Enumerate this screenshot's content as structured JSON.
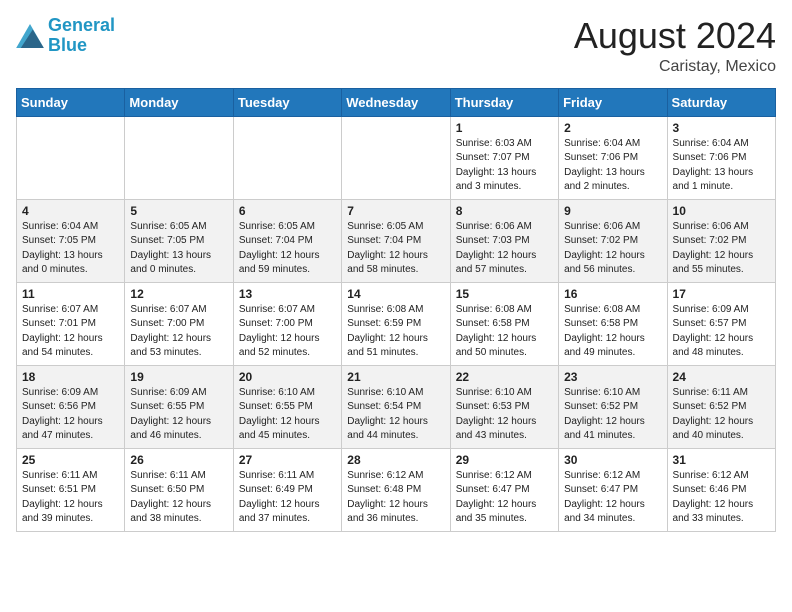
{
  "header": {
    "logo_line1": "General",
    "logo_line2": "Blue",
    "month_year": "August 2024",
    "location": "Caristay, Mexico"
  },
  "weekdays": [
    "Sunday",
    "Monday",
    "Tuesday",
    "Wednesday",
    "Thursday",
    "Friday",
    "Saturday"
  ],
  "weeks": [
    [
      {
        "day": "",
        "info": ""
      },
      {
        "day": "",
        "info": ""
      },
      {
        "day": "",
        "info": ""
      },
      {
        "day": "",
        "info": ""
      },
      {
        "day": "1",
        "info": "Sunrise: 6:03 AM\nSunset: 7:07 PM\nDaylight: 13 hours\nand 3 minutes."
      },
      {
        "day": "2",
        "info": "Sunrise: 6:04 AM\nSunset: 7:06 PM\nDaylight: 13 hours\nand 2 minutes."
      },
      {
        "day": "3",
        "info": "Sunrise: 6:04 AM\nSunset: 7:06 PM\nDaylight: 13 hours\nand 1 minute."
      }
    ],
    [
      {
        "day": "4",
        "info": "Sunrise: 6:04 AM\nSunset: 7:05 PM\nDaylight: 13 hours\nand 0 minutes."
      },
      {
        "day": "5",
        "info": "Sunrise: 6:05 AM\nSunset: 7:05 PM\nDaylight: 13 hours\nand 0 minutes."
      },
      {
        "day": "6",
        "info": "Sunrise: 6:05 AM\nSunset: 7:04 PM\nDaylight: 12 hours\nand 59 minutes."
      },
      {
        "day": "7",
        "info": "Sunrise: 6:05 AM\nSunset: 7:04 PM\nDaylight: 12 hours\nand 58 minutes."
      },
      {
        "day": "8",
        "info": "Sunrise: 6:06 AM\nSunset: 7:03 PM\nDaylight: 12 hours\nand 57 minutes."
      },
      {
        "day": "9",
        "info": "Sunrise: 6:06 AM\nSunset: 7:02 PM\nDaylight: 12 hours\nand 56 minutes."
      },
      {
        "day": "10",
        "info": "Sunrise: 6:06 AM\nSunset: 7:02 PM\nDaylight: 12 hours\nand 55 minutes."
      }
    ],
    [
      {
        "day": "11",
        "info": "Sunrise: 6:07 AM\nSunset: 7:01 PM\nDaylight: 12 hours\nand 54 minutes."
      },
      {
        "day": "12",
        "info": "Sunrise: 6:07 AM\nSunset: 7:00 PM\nDaylight: 12 hours\nand 53 minutes."
      },
      {
        "day": "13",
        "info": "Sunrise: 6:07 AM\nSunset: 7:00 PM\nDaylight: 12 hours\nand 52 minutes."
      },
      {
        "day": "14",
        "info": "Sunrise: 6:08 AM\nSunset: 6:59 PM\nDaylight: 12 hours\nand 51 minutes."
      },
      {
        "day": "15",
        "info": "Sunrise: 6:08 AM\nSunset: 6:58 PM\nDaylight: 12 hours\nand 50 minutes."
      },
      {
        "day": "16",
        "info": "Sunrise: 6:08 AM\nSunset: 6:58 PM\nDaylight: 12 hours\nand 49 minutes."
      },
      {
        "day": "17",
        "info": "Sunrise: 6:09 AM\nSunset: 6:57 PM\nDaylight: 12 hours\nand 48 minutes."
      }
    ],
    [
      {
        "day": "18",
        "info": "Sunrise: 6:09 AM\nSunset: 6:56 PM\nDaylight: 12 hours\nand 47 minutes."
      },
      {
        "day": "19",
        "info": "Sunrise: 6:09 AM\nSunset: 6:55 PM\nDaylight: 12 hours\nand 46 minutes."
      },
      {
        "day": "20",
        "info": "Sunrise: 6:10 AM\nSunset: 6:55 PM\nDaylight: 12 hours\nand 45 minutes."
      },
      {
        "day": "21",
        "info": "Sunrise: 6:10 AM\nSunset: 6:54 PM\nDaylight: 12 hours\nand 44 minutes."
      },
      {
        "day": "22",
        "info": "Sunrise: 6:10 AM\nSunset: 6:53 PM\nDaylight: 12 hours\nand 43 minutes."
      },
      {
        "day": "23",
        "info": "Sunrise: 6:10 AM\nSunset: 6:52 PM\nDaylight: 12 hours\nand 41 minutes."
      },
      {
        "day": "24",
        "info": "Sunrise: 6:11 AM\nSunset: 6:52 PM\nDaylight: 12 hours\nand 40 minutes."
      }
    ],
    [
      {
        "day": "25",
        "info": "Sunrise: 6:11 AM\nSunset: 6:51 PM\nDaylight: 12 hours\nand 39 minutes."
      },
      {
        "day": "26",
        "info": "Sunrise: 6:11 AM\nSunset: 6:50 PM\nDaylight: 12 hours\nand 38 minutes."
      },
      {
        "day": "27",
        "info": "Sunrise: 6:11 AM\nSunset: 6:49 PM\nDaylight: 12 hours\nand 37 minutes."
      },
      {
        "day": "28",
        "info": "Sunrise: 6:12 AM\nSunset: 6:48 PM\nDaylight: 12 hours\nand 36 minutes."
      },
      {
        "day": "29",
        "info": "Sunrise: 6:12 AM\nSunset: 6:47 PM\nDaylight: 12 hours\nand 35 minutes."
      },
      {
        "day": "30",
        "info": "Sunrise: 6:12 AM\nSunset: 6:47 PM\nDaylight: 12 hours\nand 34 minutes."
      },
      {
        "day": "31",
        "info": "Sunrise: 6:12 AM\nSunset: 6:46 PM\nDaylight: 12 hours\nand 33 minutes."
      }
    ]
  ]
}
